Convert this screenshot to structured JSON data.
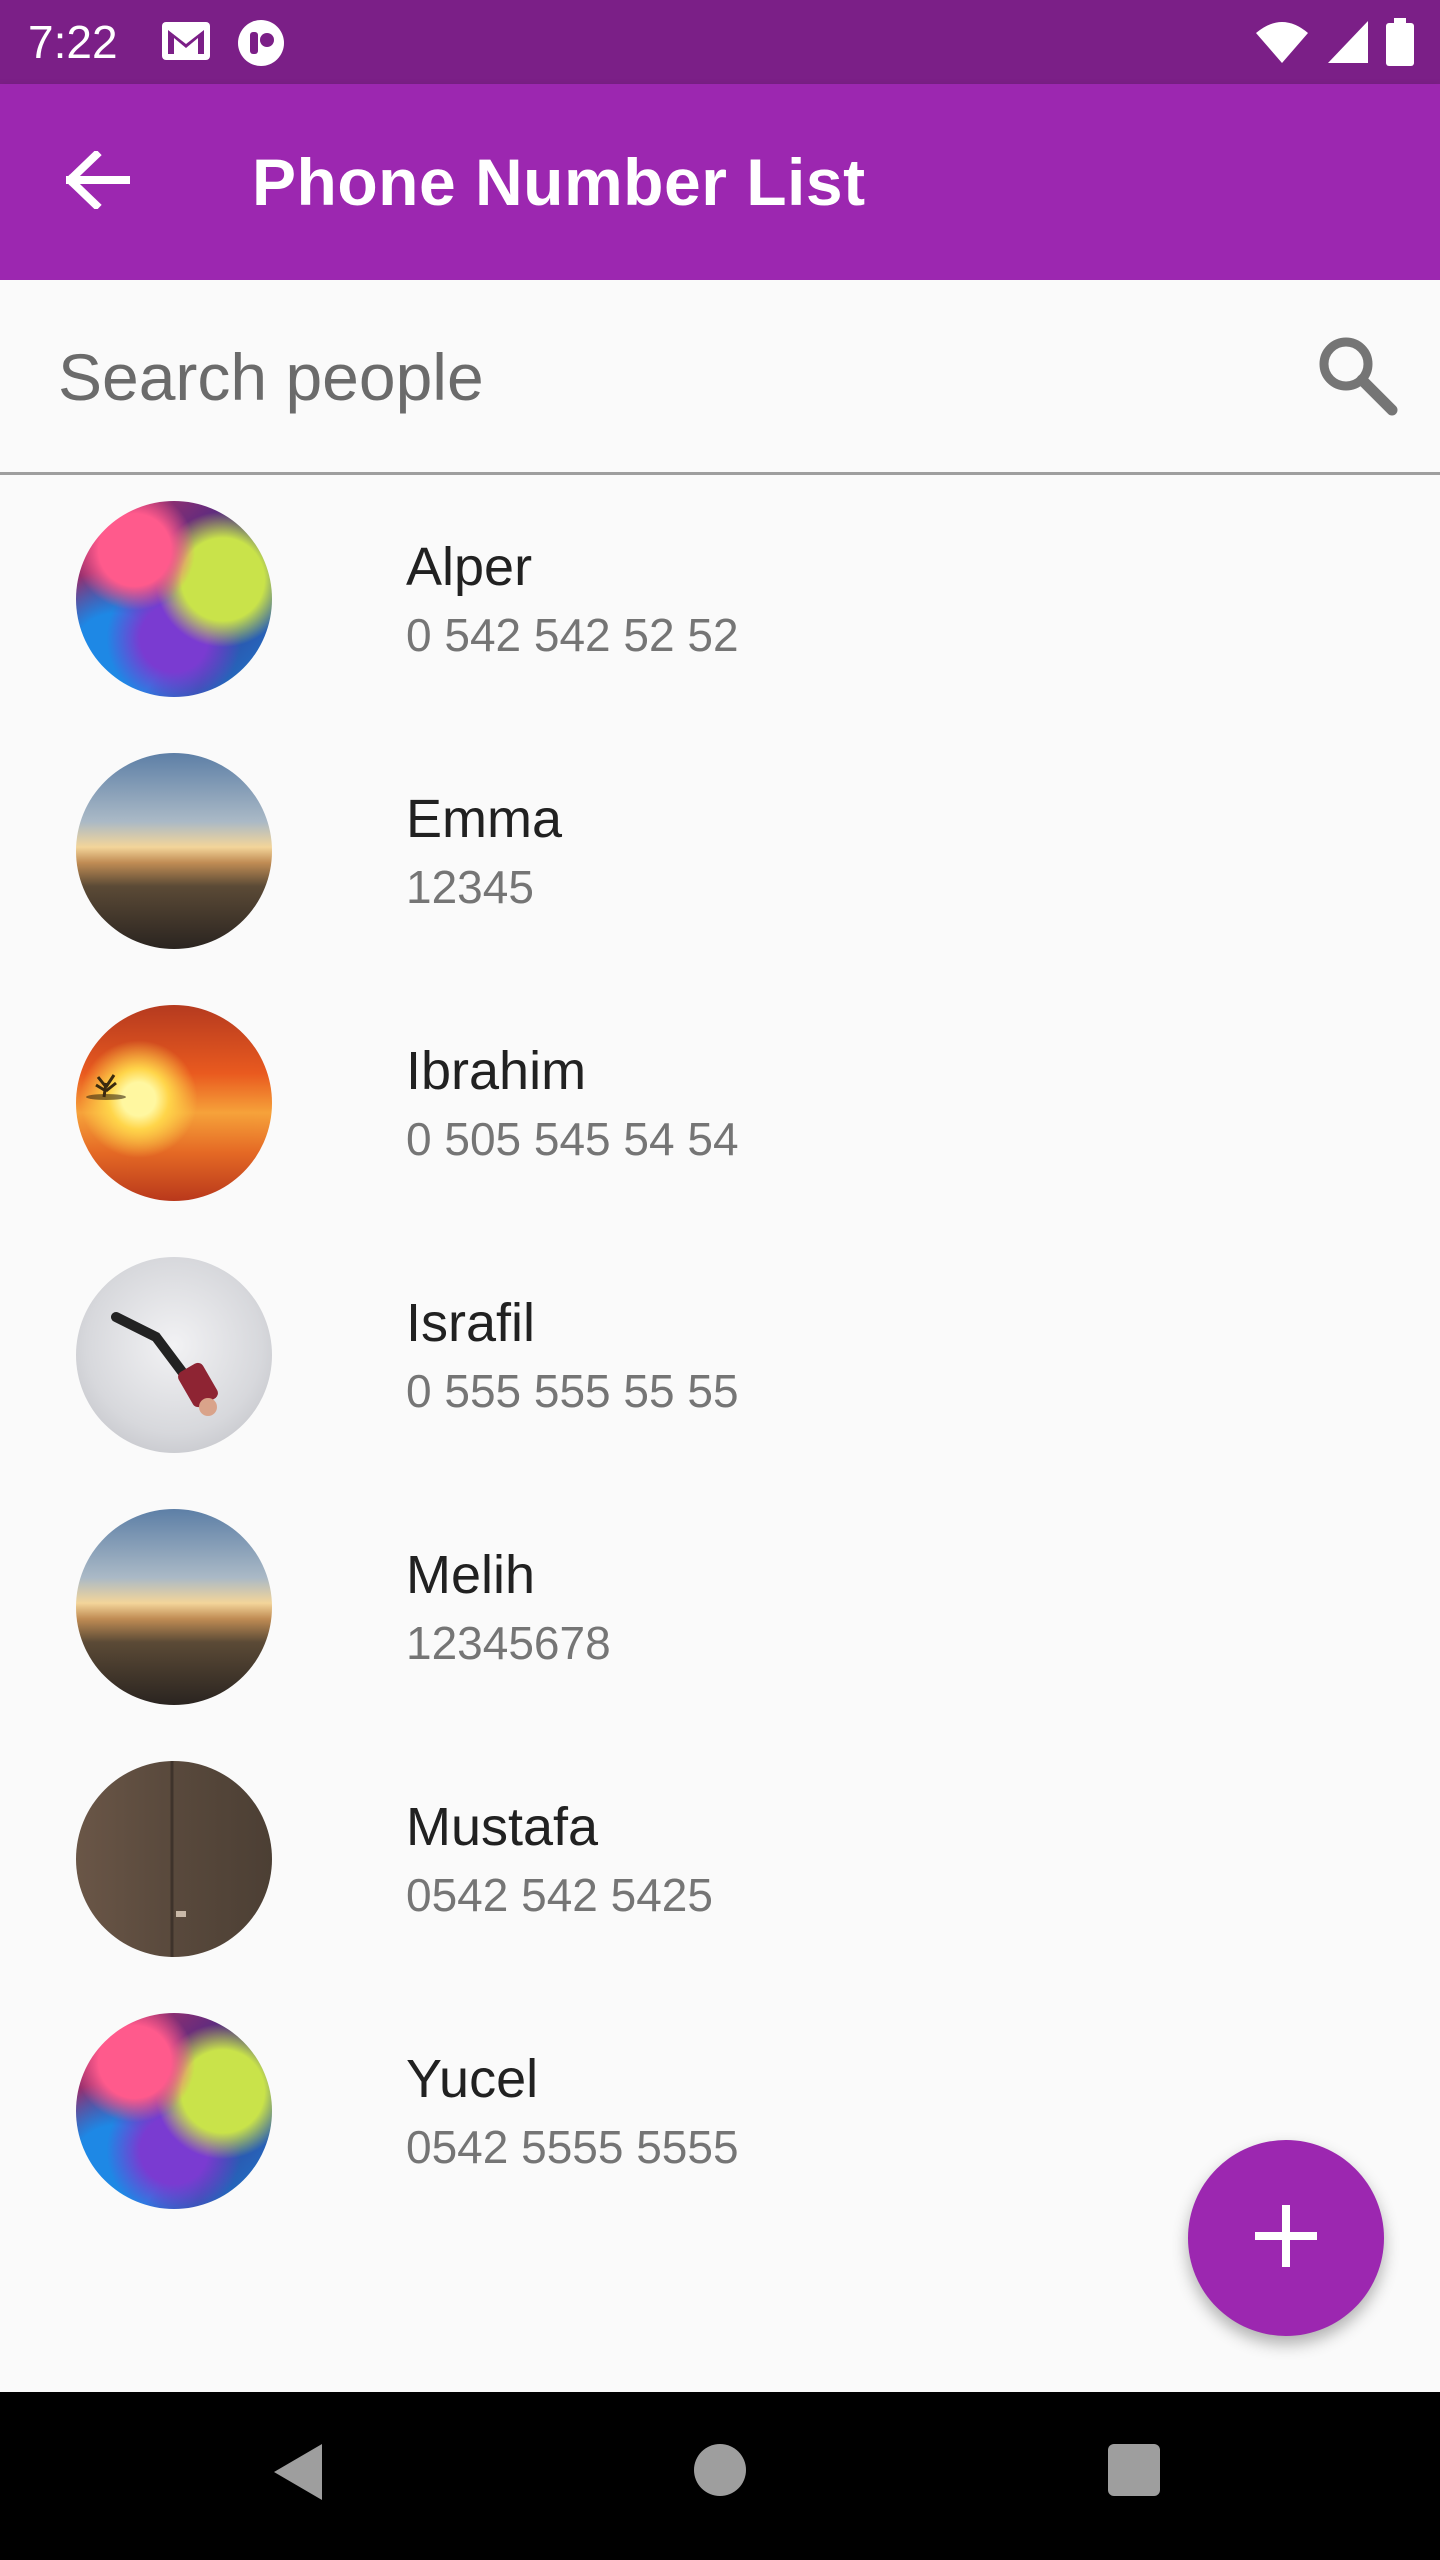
{
  "status_bar": {
    "time": "7:22",
    "icons": [
      "gmail-icon",
      "notification-app-icon",
      "wifi-icon",
      "signal-icon",
      "battery-icon"
    ]
  },
  "app_bar": {
    "title": "Phone Number List",
    "back_icon": "arrow-back-icon",
    "color": "#9c27b0"
  },
  "search": {
    "placeholder": "Search people",
    "value": "",
    "icon": "search-icon"
  },
  "contacts": [
    {
      "name": "Alper",
      "phone": "0 542 542 52 52",
      "avatar": "psychedelic-face"
    },
    {
      "name": "Emma",
      "phone": "12345",
      "avatar": "clouds-sunset"
    },
    {
      "name": "Ibrahim",
      "phone": "0 505 545 54 54",
      "avatar": "orange-sunset-tree"
    },
    {
      "name": "Israfil",
      "phone": "0 555 555 55 55",
      "avatar": "falling-person"
    },
    {
      "name": "Melih",
      "phone": "12345678",
      "avatar": "clouds-sunset"
    },
    {
      "name": "Mustafa",
      "phone": "0542 542 5425",
      "avatar": "brown-door"
    },
    {
      "name": "Yucel",
      "phone": "0542 5555 5555",
      "avatar": "psychedelic-face"
    }
  ],
  "fab": {
    "icon": "plus-icon",
    "color": "#9c27b0"
  },
  "nav_bar": {
    "icons": [
      "back-triangle-icon",
      "home-circle-icon",
      "recents-square-icon"
    ]
  }
}
